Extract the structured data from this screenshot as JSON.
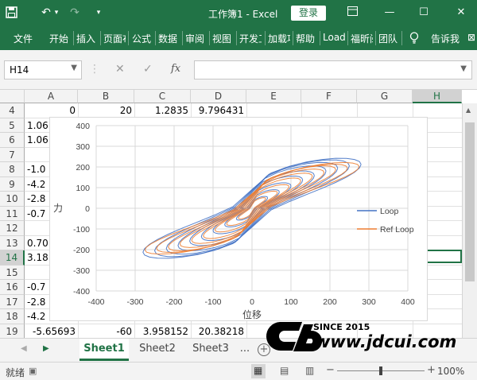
{
  "titlebar": {
    "save_icon": "save-icon",
    "undo_icon": "undo-icon",
    "redo_icon": "redo-icon",
    "title": "工作簿1  -  Excel",
    "login": "登录",
    "colors": {
      "bg": "#217346"
    }
  },
  "ribbon": {
    "tabs": [
      "文件",
      "开始",
      "插入",
      "页面布局",
      "公式",
      "数据",
      "审阅",
      "视图",
      "开发工具",
      "加载项",
      "帮助",
      "Load Test",
      "福昕阅读器",
      "团队"
    ],
    "tell": "告诉我"
  },
  "formula": {
    "namebox": "H14",
    "fx": "fx",
    "value": ""
  },
  "columns": [
    "A",
    "B",
    "C",
    "D",
    "E",
    "F",
    "G",
    "H"
  ],
  "rows": [
    {
      "n": "4",
      "a": "0",
      "b": "20",
      "c": "1.2835",
      "d": "9.796431"
    },
    {
      "n": "5",
      "a": "1.06"
    },
    {
      "n": "6",
      "a": "1.06"
    },
    {
      "n": "7",
      "a": ""
    },
    {
      "n": "8",
      "a": "-1.0"
    },
    {
      "n": "9",
      "a": "-4.2"
    },
    {
      "n": "10",
      "a": "-2.8"
    },
    {
      "n": "11",
      "a": "-0.7"
    },
    {
      "n": "12",
      "a": ""
    },
    {
      "n": "13",
      "a": "0.70"
    },
    {
      "n": "14",
      "a": "3.18"
    },
    {
      "n": "15",
      "a": ""
    },
    {
      "n": "16",
      "a": "-0.7"
    },
    {
      "n": "17",
      "a": "-2.8"
    },
    {
      "n": "18",
      "a": "-4.2"
    },
    {
      "n": "19",
      "a": "-5.65693",
      "b": "-60",
      "c": "3.958152",
      "d": "20.38218"
    }
  ],
  "chart_data": {
    "type": "scatter",
    "title": "",
    "xlabel": "位移",
    "ylabel": "力",
    "xlim": [
      -400,
      400
    ],
    "ylim": [
      -400,
      400
    ],
    "xticks": [
      "-400",
      "-300",
      "-200",
      "-100",
      "0",
      "100",
      "200",
      "300",
      "400"
    ],
    "yticks": [
      "400",
      "300",
      "200",
      "100",
      "0",
      "-100",
      "-200",
      "-300",
      "-400"
    ],
    "grid": true,
    "legend_position": "right",
    "series": [
      {
        "name": "Loop",
        "color": "#4472C4",
        "amp": [
          40,
          70,
          100,
          130,
          160,
          190,
          220,
          250,
          280
        ],
        "force": [
          70,
          110,
          150,
          190,
          220,
          250,
          270,
          285,
          295
        ]
      },
      {
        "name": "Ref Loop",
        "color": "#ED7D31",
        "amp": [
          35,
          65,
          95,
          125,
          155,
          185,
          215,
          245,
          275
        ],
        "force": [
          65,
          105,
          145,
          185,
          215,
          240,
          260,
          270,
          280
        ]
      }
    ]
  },
  "sheets": [
    "Sheet1",
    "Sheet2",
    "Sheet3",
    "..."
  ],
  "status": {
    "ready": "就绪",
    "zoom": "100%"
  },
  "watermark": {
    "since": "SINCE 2015",
    "site": "www.jdcui.com"
  }
}
